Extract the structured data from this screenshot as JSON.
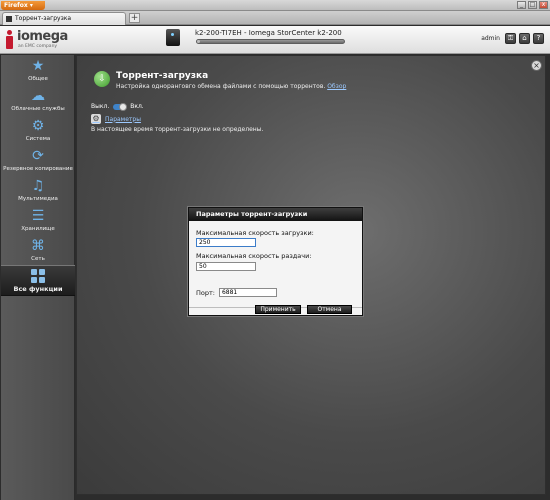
{
  "browser": {
    "app_button": "Firefox",
    "tab_title": "Торрент-загрузка",
    "new_tab": "+",
    "window_buttons": {
      "minimize": "_",
      "maximize": "□",
      "close": "x"
    }
  },
  "header": {
    "logo_name": "iomega",
    "logo_sub": "an EMC company",
    "device_title": "k2-200-TI7EH - Iomega StorCenter k2-200",
    "device_capacity_fraction": 0.02,
    "user": "admin",
    "icons": [
      "user-key-icon",
      "home-icon",
      "help-icon"
    ],
    "help_glyph": "?",
    "home_glyph": "⌂",
    "key_glyph": "⚿"
  },
  "sidebar": {
    "items": [
      {
        "label": "Общее",
        "icon": "star-icon",
        "glyph": "★"
      },
      {
        "label": "Облачные службы",
        "icon": "cloud-icon",
        "glyph": "☁"
      },
      {
        "label": "Система",
        "icon": "gear-icon",
        "glyph": "⚙"
      },
      {
        "label": "Резервное копирование",
        "icon": "backup-icon",
        "glyph": "⟳"
      },
      {
        "label": "Мультимедиа",
        "icon": "media-icon",
        "glyph": "♫"
      },
      {
        "label": "Хранилище",
        "icon": "storage-icon",
        "glyph": "☰"
      },
      {
        "label": "Сеть",
        "icon": "network-icon",
        "glyph": "⌘"
      }
    ],
    "all_functions": "Все функции"
  },
  "main": {
    "close_glyph": "×",
    "icon_glyph": "⇩",
    "title": "Торрент-загрузка",
    "description": "Настройка одноранговго обмена файлами с помощью торрентов.",
    "overview_link": "Обзор",
    "toggle_off": "Выкл.",
    "toggle_on": "Вкл.",
    "toggle_state": "on",
    "params_link": "Параметры",
    "gear_glyph": "⚙",
    "status": "В настоящее время торрент-загрузки не определены."
  },
  "dialog": {
    "title": "Параметры торрент-загрузки",
    "max_download_label": "Максимальная скорость загрузки:",
    "max_download_value": "250",
    "max_upload_label": "Максимальная скорость раздачи:",
    "max_upload_value": "50",
    "port_label": "Порт:",
    "port_value": "6881",
    "apply_button": "Применить",
    "cancel_button": "Отмена"
  },
  "colors": {
    "brand_red": "#c41a2f",
    "accent_blue": "#3e83c9",
    "link_blue": "#9cc9ff"
  }
}
